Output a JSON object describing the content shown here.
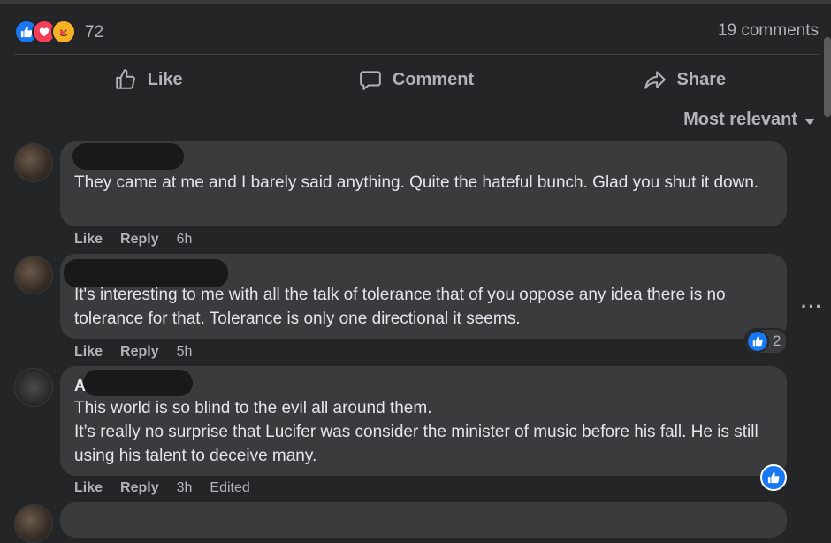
{
  "summary": {
    "reaction_count": "72",
    "comments_count": "19 comments",
    "reaction_icons": [
      "like-icon",
      "love-icon",
      "care-icon"
    ]
  },
  "actions": {
    "like": "Like",
    "comment": "Comment",
    "share": "Share"
  },
  "sort": {
    "label": "Most relevant"
  },
  "comments": [
    {
      "text": "They came at me and I barely said anything. Quite the hateful bunch. Glad you shut it down.",
      "like": "Like",
      "reply": "Reply",
      "time": "6h"
    },
    {
      "text": "It's interesting to me with all the talk of tolerance that of you oppose any idea there is no tolerance for that. Tolerance is only one directional it seems.",
      "like": "Like",
      "reply": "Reply",
      "time": "5h",
      "reactions": "2"
    },
    {
      "initial": "A",
      "line1": "This world is so blind to the evil all around them.",
      "line2": "It’s really no surprise that Lucifer was consider the minister of music before his fall. He is still using his talent to deceive many.",
      "like": "Like",
      "reply": "Reply",
      "time": "3h",
      "edited": "Edited"
    }
  ],
  "colors": {
    "background": "#242526",
    "bubble": "#3a3b3c",
    "text": "#e4e6eb",
    "secondary": "#b0b3b8",
    "like_blue": "#1877f2",
    "love_red": "#f33e58"
  }
}
